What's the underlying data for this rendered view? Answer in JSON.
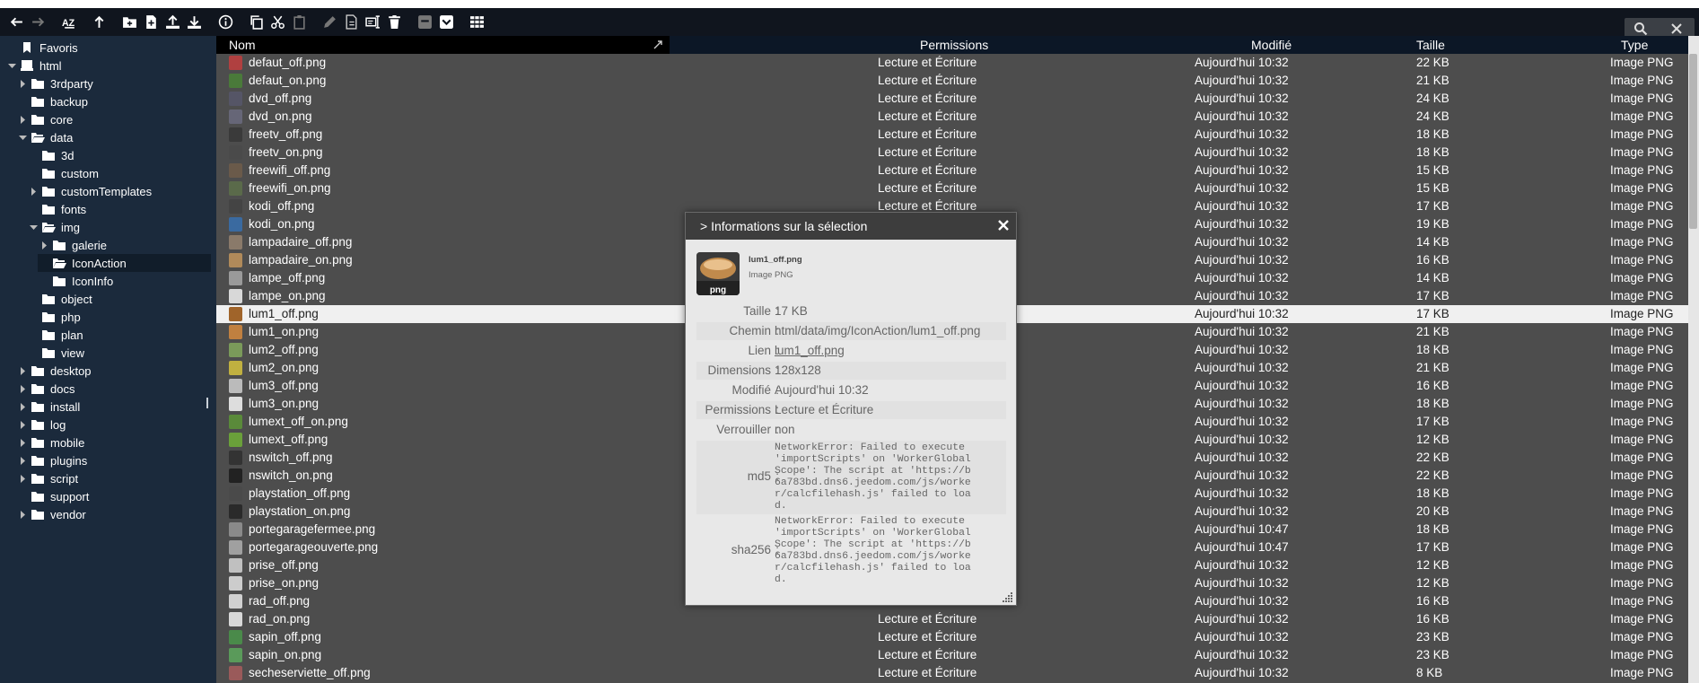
{
  "toolbar": {
    "buttons": [
      "back-icon",
      "forward-icon",
      "sort-az-icon",
      "up-icon",
      "new-folder-icon",
      "new-file-icon",
      "upload-icon",
      "download-icon",
      "info-icon",
      "copy-icon",
      "cut-icon",
      "paste-icon",
      "edit-icon",
      "duplicate-icon",
      "rename-icon",
      "delete-icon",
      "archive-icon",
      "extract-icon",
      "view-grid-icon"
    ]
  },
  "sidebar": {
    "items": [
      {
        "label": "Favoris"
      },
      {
        "label": "html"
      },
      {
        "label": "3rdparty"
      },
      {
        "label": "backup"
      },
      {
        "label": "core"
      },
      {
        "label": "data"
      },
      {
        "label": "3d"
      },
      {
        "label": "custom"
      },
      {
        "label": "customTemplates"
      },
      {
        "label": "fonts"
      },
      {
        "label": "img"
      },
      {
        "label": "galerie"
      },
      {
        "label": "IconAction"
      },
      {
        "label": "IconInfo"
      },
      {
        "label": "object"
      },
      {
        "label": "php"
      },
      {
        "label": "plan"
      },
      {
        "label": "view"
      },
      {
        "label": "desktop"
      },
      {
        "label": "docs"
      },
      {
        "label": "install"
      },
      {
        "label": "log"
      },
      {
        "label": "mobile"
      },
      {
        "label": "plugins"
      },
      {
        "label": "script"
      },
      {
        "label": "support"
      },
      {
        "label": "vendor"
      }
    ]
  },
  "columns": {
    "name": "Nom",
    "perms": "Permissions",
    "modified": "Modifié",
    "size": "Taille",
    "type": "Type"
  },
  "files": [
    {
      "name": "defaut_off.png",
      "perms": "Lecture et Écriture",
      "modified": "Aujourd'hui 10:32",
      "size": "22 KB",
      "type": "Image PNG"
    },
    {
      "name": "defaut_on.png",
      "perms": "Lecture et Écriture",
      "modified": "Aujourd'hui 10:32",
      "size": "21 KB",
      "type": "Image PNG"
    },
    {
      "name": "dvd_off.png",
      "perms": "Lecture et Écriture",
      "modified": "Aujourd'hui 10:32",
      "size": "24 KB",
      "type": "Image PNG"
    },
    {
      "name": "dvd_on.png",
      "perms": "Lecture et Écriture",
      "modified": "Aujourd'hui 10:32",
      "size": "24 KB",
      "type": "Image PNG"
    },
    {
      "name": "freetv_off.png",
      "perms": "Lecture et Écriture",
      "modified": "Aujourd'hui 10:32",
      "size": "18 KB",
      "type": "Image PNG"
    },
    {
      "name": "freetv_on.png",
      "perms": "Lecture et Écriture",
      "modified": "Aujourd'hui 10:32",
      "size": "18 KB",
      "type": "Image PNG"
    },
    {
      "name": "freewifi_off.png",
      "perms": "Lecture et Écriture",
      "modified": "Aujourd'hui 10:32",
      "size": "15 KB",
      "type": "Image PNG"
    },
    {
      "name": "freewifi_on.png",
      "perms": "Lecture et Écriture",
      "modified": "Aujourd'hui 10:32",
      "size": "15 KB",
      "type": "Image PNG"
    },
    {
      "name": "kodi_off.png",
      "perms": "Lecture et Écriture",
      "modified": "Aujourd'hui 10:32",
      "size": "17 KB",
      "type": "Image PNG"
    },
    {
      "name": "kodi_on.png",
      "perms": "",
      "modified": "Aujourd'hui 10:32",
      "size": "19 KB",
      "type": "Image PNG"
    },
    {
      "name": "lampadaire_off.png",
      "perms": "",
      "modified": "Aujourd'hui 10:32",
      "size": "14 KB",
      "type": "Image PNG"
    },
    {
      "name": "lampadaire_on.png",
      "perms": "",
      "modified": "Aujourd'hui 10:32",
      "size": "16 KB",
      "type": "Image PNG"
    },
    {
      "name": "lampe_off.png",
      "perms": "",
      "modified": "Aujourd'hui 10:32",
      "size": "14 KB",
      "type": "Image PNG"
    },
    {
      "name": "lampe_on.png",
      "perms": "",
      "modified": "Aujourd'hui 10:32",
      "size": "17 KB",
      "type": "Image PNG"
    },
    {
      "name": "lum1_off.png",
      "perms": "",
      "modified": "Aujourd'hui 10:32",
      "size": "17 KB",
      "type": "Image PNG"
    },
    {
      "name": "lum1_on.png",
      "perms": "",
      "modified": "Aujourd'hui 10:32",
      "size": "21 KB",
      "type": "Image PNG"
    },
    {
      "name": "lum2_off.png",
      "perms": "",
      "modified": "Aujourd'hui 10:32",
      "size": "18 KB",
      "type": "Image PNG"
    },
    {
      "name": "lum2_on.png",
      "perms": "",
      "modified": "Aujourd'hui 10:32",
      "size": "21 KB",
      "type": "Image PNG"
    },
    {
      "name": "lum3_off.png",
      "perms": "",
      "modified": "Aujourd'hui 10:32",
      "size": "16 KB",
      "type": "Image PNG"
    },
    {
      "name": "lum3_on.png",
      "perms": "",
      "modified": "Aujourd'hui 10:32",
      "size": "18 KB",
      "type": "Image PNG"
    },
    {
      "name": "lumext_off_on.png",
      "perms": "",
      "modified": "Aujourd'hui 10:32",
      "size": "17 KB",
      "type": "Image PNG"
    },
    {
      "name": "lumext_off.png",
      "perms": "",
      "modified": "Aujourd'hui 10:32",
      "size": "12 KB",
      "type": "Image PNG"
    },
    {
      "name": "nswitch_off.png",
      "perms": "",
      "modified": "Aujourd'hui 10:32",
      "size": "22 KB",
      "type": "Image PNG"
    },
    {
      "name": "nswitch_on.png",
      "perms": "",
      "modified": "Aujourd'hui 10:32",
      "size": "22 KB",
      "type": "Image PNG"
    },
    {
      "name": "playstation_off.png",
      "perms": "",
      "modified": "Aujourd'hui 10:32",
      "size": "18 KB",
      "type": "Image PNG"
    },
    {
      "name": "playstation_on.png",
      "perms": "",
      "modified": "Aujourd'hui 10:32",
      "size": "20 KB",
      "type": "Image PNG"
    },
    {
      "name": "portegaragefermee.png",
      "perms": "",
      "modified": "Aujourd'hui 10:47",
      "size": "18 KB",
      "type": "Image PNG"
    },
    {
      "name": "portegarageouverte.png",
      "perms": "",
      "modified": "Aujourd'hui 10:47",
      "size": "17 KB",
      "type": "Image PNG"
    },
    {
      "name": "prise_off.png",
      "perms": "",
      "modified": "Aujourd'hui 10:32",
      "size": "12 KB",
      "type": "Image PNG"
    },
    {
      "name": "prise_on.png",
      "perms": "",
      "modified": "Aujourd'hui 10:32",
      "size": "12 KB",
      "type": "Image PNG"
    },
    {
      "name": "rad_off.png",
      "perms": "",
      "modified": "Aujourd'hui 10:32",
      "size": "16 KB",
      "type": "Image PNG"
    },
    {
      "name": "rad_on.png",
      "perms": "Lecture et Écriture",
      "modified": "Aujourd'hui 10:32",
      "size": "16 KB",
      "type": "Image PNG"
    },
    {
      "name": "sapin_off.png",
      "perms": "Lecture et Écriture",
      "modified": "Aujourd'hui 10:32",
      "size": "23 KB",
      "type": "Image PNG"
    },
    {
      "name": "sapin_on.png",
      "perms": "Lecture et Écriture",
      "modified": "Aujourd'hui 10:32",
      "size": "23 KB",
      "type": "Image PNG"
    },
    {
      "name": "secheserviette_off.png",
      "perms": "Lecture et Écriture",
      "modified": "Aujourd'hui 10:32",
      "size": "8 KB",
      "type": "Image PNG"
    }
  ],
  "dialog": {
    "title": "> Informations sur la sélection",
    "thumb_label": "png",
    "file_name": "lum1_off.png",
    "file_type": "Image PNG",
    "props": [
      {
        "label": "Taille",
        "value": "17 KB"
      },
      {
        "label": "Chemin",
        "value": "html/data/img/IconAction/lum1_off.png"
      },
      {
        "label": "Lien",
        "value": "lum1_off.png"
      },
      {
        "label": "Dimensions",
        "value": "128x128"
      },
      {
        "label": "Modifié",
        "value": "Aujourd'hui 10:32"
      },
      {
        "label": "Permissions",
        "value": "Lecture et Écriture"
      },
      {
        "label": "Verrouiller",
        "value": "non"
      },
      {
        "label": "md5",
        "value": "NetworkError: Failed to execute\n'importScripts' on 'WorkerGlobal\nScope': The script at 'https://b\n6a783bd.dns6.jeedom.com/js/worke\nr/calcfilehash.js' failed to loa\nd."
      },
      {
        "label": "sha256",
        "value": "NetworkError: Failed to execute\n'importScripts' on 'WorkerGlobal\nScope': The script at 'https://b\n6a783bd.dns6.jeedom.com/js/worke\nr/calcfilehash.js' failed to loa\nd."
      }
    ]
  },
  "colors": {
    "sidebar": "#1b2a3c",
    "toolbar": "#10151e",
    "list_bg": "#4d4d4d",
    "selected_row": "#f0f0f0",
    "dialog_title": "#3d3d3d"
  }
}
